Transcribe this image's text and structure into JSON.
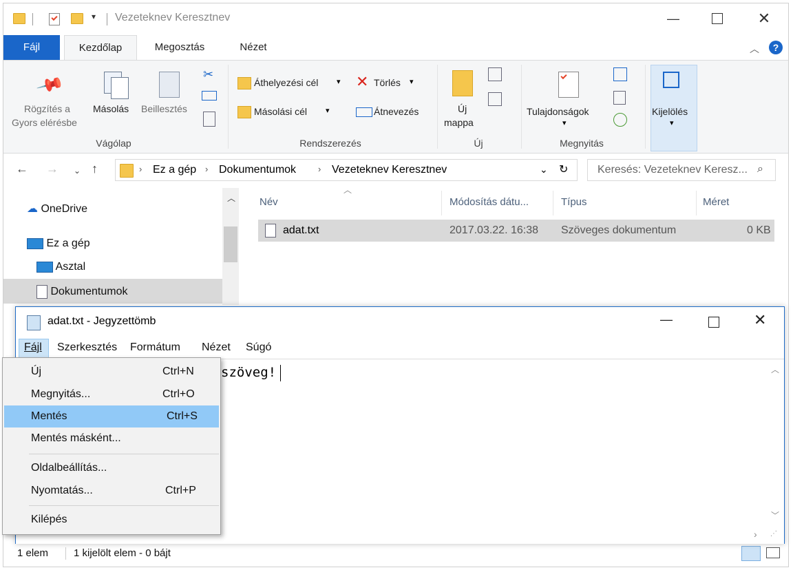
{
  "explorer": {
    "title": "Vezeteknev Keresztnev",
    "tabs": [
      "Fájl",
      "Kezdőlap",
      "Megosztás",
      "Nézet"
    ],
    "ribbon": {
      "pin": [
        "Rögzítés a",
        "Gyors elérésbe"
      ],
      "copy": "Másolás",
      "paste": "Beillesztés",
      "clipboard_group": "Vágólap",
      "move_to": "Áthelyezési cél",
      "copy_to": "Másolási cél",
      "delete": "Törlés",
      "rename": "Átnevezés",
      "organize_group": "Rendszerezés",
      "new_folder": [
        "Új",
        "mappa"
      ],
      "new_group": "Új",
      "properties": "Tulajdonságok",
      "open_group": "Megnyitás",
      "select": "Kijelölés"
    },
    "address": {
      "crumbs": [
        "Ez a gép",
        "Dokumentumok",
        "Vezeteknev Keresztnev"
      ],
      "search_placeholder": "Keresés: Vezeteknev Keresz..."
    },
    "nav": [
      {
        "label": "OneDrive",
        "icon": "cloud-icon"
      },
      {
        "label": "Ez a gép",
        "icon": "computer-icon"
      },
      {
        "label": "Asztal",
        "icon": "desktop-icon"
      },
      {
        "label": "Dokumentumok",
        "icon": "documents-icon"
      }
    ],
    "columns": [
      "Név",
      "Módosítás dátu...",
      "Típus",
      "Méret"
    ],
    "files": [
      {
        "name": "adat.txt",
        "modified": "2017.03.22. 16:38",
        "type": "Szöveges dokumentum",
        "size": "0 KB"
      }
    ],
    "status": {
      "count": "1 elem",
      "selected": "1 kijelölt elem - 0 bájt"
    }
  },
  "notepad": {
    "title": "adat.txt - Jegyzettömb",
    "menus": [
      "Fájl",
      "Szerkesztés",
      "Formátum",
      "Nézet",
      "Súgó"
    ],
    "content_visible": "szöveg!"
  },
  "file_menu": {
    "items": [
      {
        "label": "Új",
        "shortcut": "Ctrl+N"
      },
      {
        "label": "Megnyitás...",
        "shortcut": "Ctrl+O"
      },
      {
        "label": "Mentés",
        "shortcut": "Ctrl+S",
        "highlighted": true
      },
      {
        "label": "Mentés másként...",
        "shortcut": ""
      },
      {
        "label": "Oldalbeállítás...",
        "shortcut": ""
      },
      {
        "label": "Nyomtatás...",
        "shortcut": "Ctrl+P"
      },
      {
        "label": "Kilépés",
        "shortcut": ""
      }
    ]
  },
  "colors": {
    "accent": "#1a66c9",
    "highlight": "#91c9f7",
    "selected_row": "#d9d9d9"
  }
}
